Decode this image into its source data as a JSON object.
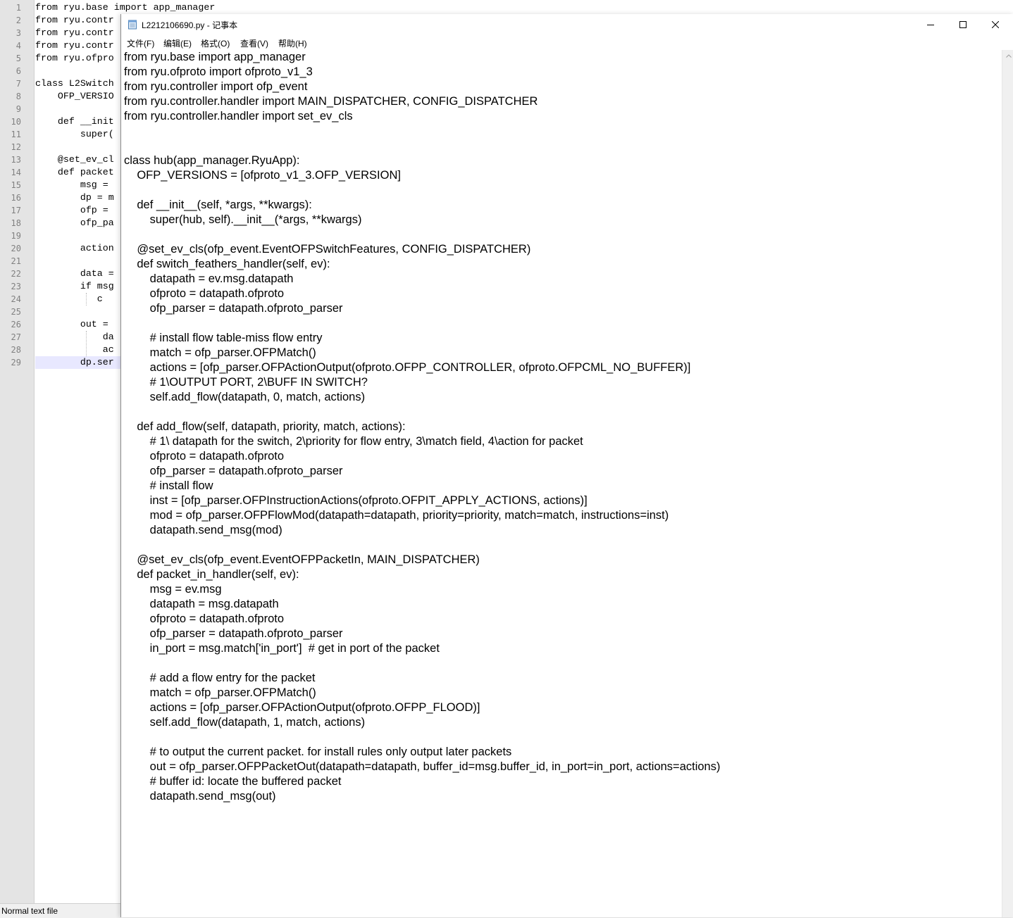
{
  "background_editor": {
    "line_numbers": [
      "1",
      "2",
      "3",
      "4",
      "5",
      "6",
      "7",
      "8",
      "9",
      "10",
      "11",
      "12",
      "13",
      "14",
      "15",
      "16",
      "17",
      "18",
      "19",
      "20",
      "21",
      "22",
      "23",
      "24",
      "25",
      "26",
      "27",
      "28",
      "29"
    ],
    "code_lines": [
      "from ryu.base import app_manager",
      "from ryu.contr",
      "from ryu.contr",
      "from ryu.contr",
      "from ryu.ofpro",
      "",
      "class L2Switch",
      "    OFP_VERSIO",
      "",
      "    def __init",
      "        super(",
      "",
      "    @set_ev_cl",
      "    def packet",
      "        msg = ",
      "        dp = m",
      "        ofp = ",
      "        ofp_pa",
      "",
      "        action",
      "",
      "        data =",
      "        if msg",
      "           c",
      "",
      "        out = ",
      "            da",
      "            ac",
      "        dp.ser"
    ],
    "status_text": "Normal text file"
  },
  "notepad": {
    "title": "L2212106690.py - 记事本",
    "menu": [
      "文件(F)",
      "编辑(E)",
      "格式(O)",
      "查看(V)",
      "帮助(H)"
    ],
    "lines": [
      "from ryu.base import app_manager",
      "from ryu.ofproto import ofproto_v1_3",
      "from ryu.controller import ofp_event",
      "from ryu.controller.handler import MAIN_DISPATCHER, CONFIG_DISPATCHER",
      "from ryu.controller.handler import set_ev_cls",
      "",
      "",
      "class hub(app_manager.RyuApp):",
      "    OFP_VERSIONS = [ofproto_v1_3.OFP_VERSION]",
      "",
      "    def __init__(self, *args, **kwargs):",
      "        super(hub, self).__init__(*args, **kwargs)",
      "",
      "    @set_ev_cls(ofp_event.EventOFPSwitchFeatures, CONFIG_DISPATCHER)",
      "    def switch_feathers_handler(self, ev):",
      "        datapath = ev.msg.datapath",
      "        ofproto = datapath.ofproto",
      "        ofp_parser = datapath.ofproto_parser",
      "",
      "        # install flow table-miss flow entry",
      "        match = ofp_parser.OFPMatch()",
      "        actions = [ofp_parser.OFPActionOutput(ofproto.OFPP_CONTROLLER, ofproto.OFPCML_NO_BUFFER)]",
      "        # 1\\OUTPUT PORT, 2\\BUFF IN SWITCH?",
      "        self.add_flow(datapath, 0, match, actions)",
      "",
      "    def add_flow(self, datapath, priority, match, actions):",
      "        # 1\\ datapath for the switch, 2\\priority for flow entry, 3\\match field, 4\\action for packet",
      "        ofproto = datapath.ofproto",
      "        ofp_parser = datapath.ofproto_parser",
      "        # install flow",
      "        inst = [ofp_parser.OFPInstructionActions(ofproto.OFPIT_APPLY_ACTIONS, actions)]",
      "        mod = ofp_parser.OFPFlowMod(datapath=datapath, priority=priority, match=match, instructions=inst)",
      "        datapath.send_msg(mod)",
      "",
      "    @set_ev_cls(ofp_event.EventOFPPacketIn, MAIN_DISPATCHER)",
      "    def packet_in_handler(self, ev):",
      "        msg = ev.msg",
      "        datapath = msg.datapath",
      "        ofproto = datapath.ofproto",
      "        ofp_parser = datapath.ofproto_parser",
      "        in_port = msg.match['in_port']  # get in port of the packet",
      "",
      "        # add a flow entry for the packet",
      "        match = ofp_parser.OFPMatch()",
      "        actions = [ofp_parser.OFPActionOutput(ofproto.OFPP_FLOOD)]",
      "        self.add_flow(datapath, 1, match, actions)",
      "",
      "        # to output the current packet. for install rules only output later packets",
      "        out = ofp_parser.OFPPacketOut(datapath=datapath, buffer_id=msg.buffer_id, in_port=in_port, actions=actions)",
      "        # buffer id: locate the buffered packet",
      "        datapath.send_msg(out)"
    ]
  },
  "icons": {
    "app": "notepad-icon",
    "minimize": "minimize-icon",
    "maximize": "maximize-icon",
    "close": "close-icon",
    "scroll_up": "chevron-up-icon"
  },
  "colors": {
    "gutter": "#e4e4e4",
    "current_line": "#e8e8ff",
    "scrollbar": "#f0f0f0"
  }
}
